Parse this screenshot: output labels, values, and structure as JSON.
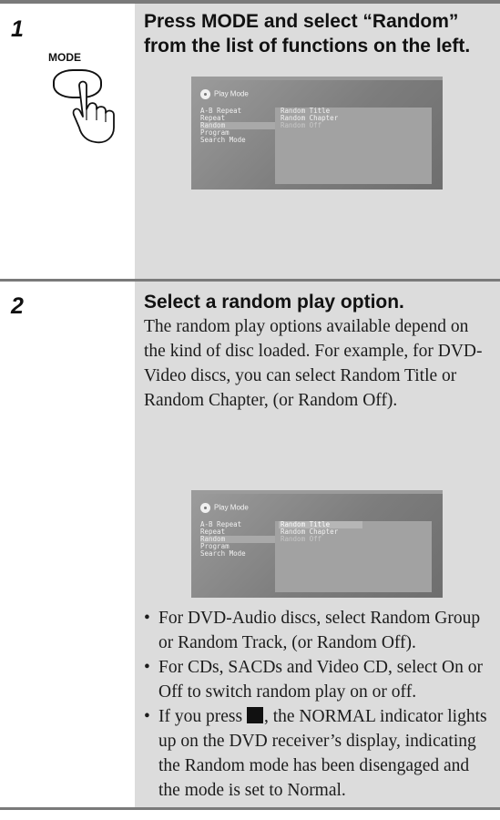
{
  "steps": [
    {
      "number": "1",
      "heading_line1": "Press MODE and select “Random”",
      "heading_line2": "from the list of functions on the left.",
      "illustration": {
        "button_label": "MODE",
        "icon": "hand-press-icon"
      }
    },
    {
      "number": "2",
      "heading": "Select a random play option.",
      "body": "The random play options available depend on the kind of disc loaded. For example, for DVD-Video discs, you can select Random Title or Random Chapter, (or Random Off).",
      "bullets": [
        "For DVD-Audio discs, select Random Group or Random Track, (or Random Off).",
        "For CDs, SACDs and Video CD, select On or Off to switch random play on or off."
      ],
      "bullet3_after_icon": ", the NORMAL indicator lights up on the DVD receiver’s display, indicating the Random mode has been disengaged and the mode is set to Normal.",
      "bullet3_before_icon": "If you press ",
      "stop_icon": "stop-button-icon"
    }
  ],
  "osd": {
    "title": "Play Mode",
    "menu_items": [
      "A-B Repeat",
      "Repeat",
      "Random",
      "Program",
      "Search Mode"
    ],
    "selected_menu_index": 2,
    "options": [
      "Random Title",
      "Random Chapter",
      "Random Off"
    ]
  },
  "colors": {
    "shaded_column": "#dcdcdc",
    "rule": "#7a7a7a",
    "osd_background": "#7d7d7d"
  }
}
